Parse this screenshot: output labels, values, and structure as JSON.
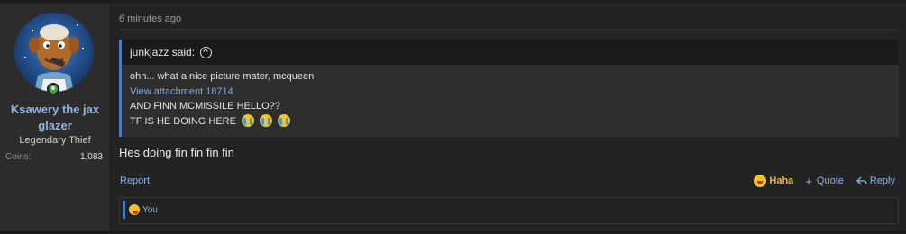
{
  "user": {
    "name": "Ksawery the jax glazer",
    "title": "Legendary Thief",
    "coins_label": "Coins:",
    "coins_value": "1,083"
  },
  "post": {
    "timestamp": "6 minutes ago",
    "quote": {
      "author_line": "junkjazz said:",
      "lines": [
        "ohh... what a nice picture mater, mcqueen",
        "View attachment 18714",
        "AND FINN MCMISSILE HELLO??",
        "TF IS HE DOING HERE"
      ]
    },
    "message": "Hes doing fin fin fin fin",
    "actions": {
      "report": "Report",
      "reaction": "Haha",
      "quote": "Quote",
      "reply": "Reply"
    },
    "reactions_summary": "You"
  },
  "icons": {
    "reaction_emoji": "laughing-face-icon",
    "crying_emoji": "loudly-crying-face-icon",
    "online": "online-status-icon"
  }
}
